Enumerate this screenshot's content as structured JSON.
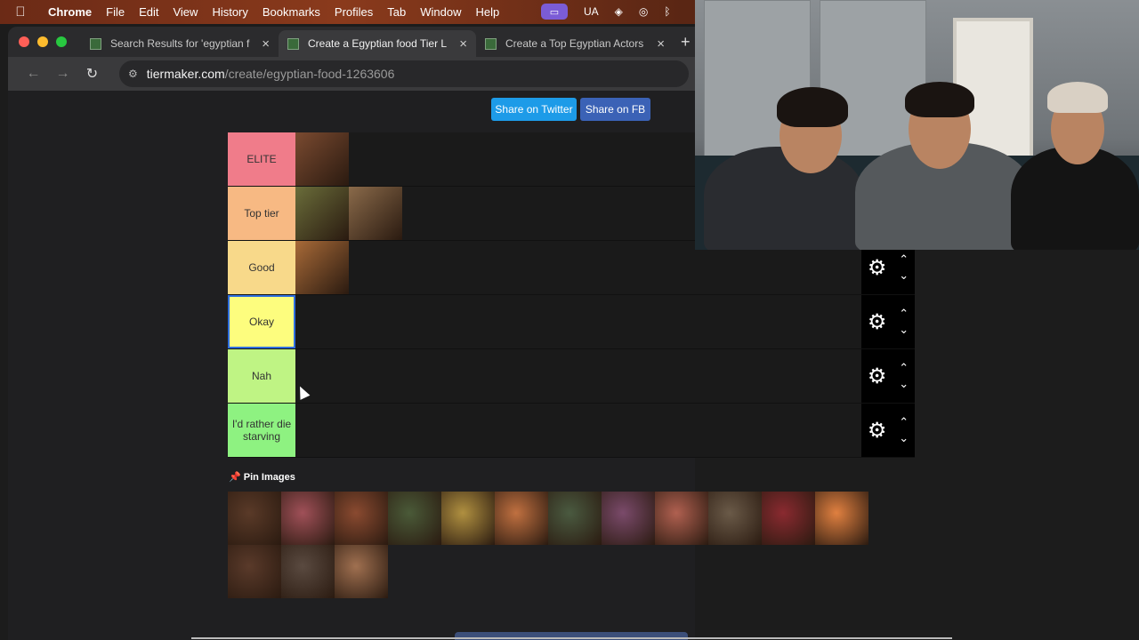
{
  "menubar": {
    "items": [
      "Chrome",
      "File",
      "Edit",
      "View",
      "History",
      "Bookmarks",
      "Profiles",
      "Tab",
      "Window",
      "Help"
    ],
    "status": {
      "input_source": "UA"
    }
  },
  "browser": {
    "tabs": [
      {
        "label": "Search Results for 'egyptian f",
        "active": false
      },
      {
        "label": "Create a Egyptian food Tier L",
        "active": true
      },
      {
        "label": "Create a Top Egyptian Actors",
        "active": false
      }
    ],
    "url_host": "tiermaker.com",
    "url_path": "/create/egyptian-food-1263606"
  },
  "share": {
    "twitter": "Share on Twitter",
    "facebook": "Share on FB"
  },
  "tiers": [
    {
      "label": "ELITE",
      "color": "#f07c8a",
      "items": [
        "#7a4a30"
      ]
    },
    {
      "label": "Top tier",
      "color": "#f7b983",
      "items": [
        "#6a6d3a",
        "#8a6a4a"
      ]
    },
    {
      "label": "Good",
      "color": "#f8d98a",
      "items": [
        "#a86a38"
      ]
    },
    {
      "label": "Okay",
      "color": "#fdfd7e",
      "items": [],
      "editing": true
    },
    {
      "label": "Nah",
      "color": "#bff484",
      "items": []
    },
    {
      "label": "I'd rather die starving",
      "color": "#8ef281",
      "items": []
    }
  ],
  "pool": {
    "title": "📌 Pin Images",
    "items": [
      "#5a3a28",
      "#a05058",
      "#8a4a30",
      "#4a5a38",
      "#b09040",
      "#c07040",
      "#4a5a40",
      "#7a4a6a",
      "#b06050",
      "#6a5a48",
      "#8a2a30",
      "#e08040",
      "#5a3a2a",
      "#5a4a40",
      "#a07050"
    ]
  }
}
